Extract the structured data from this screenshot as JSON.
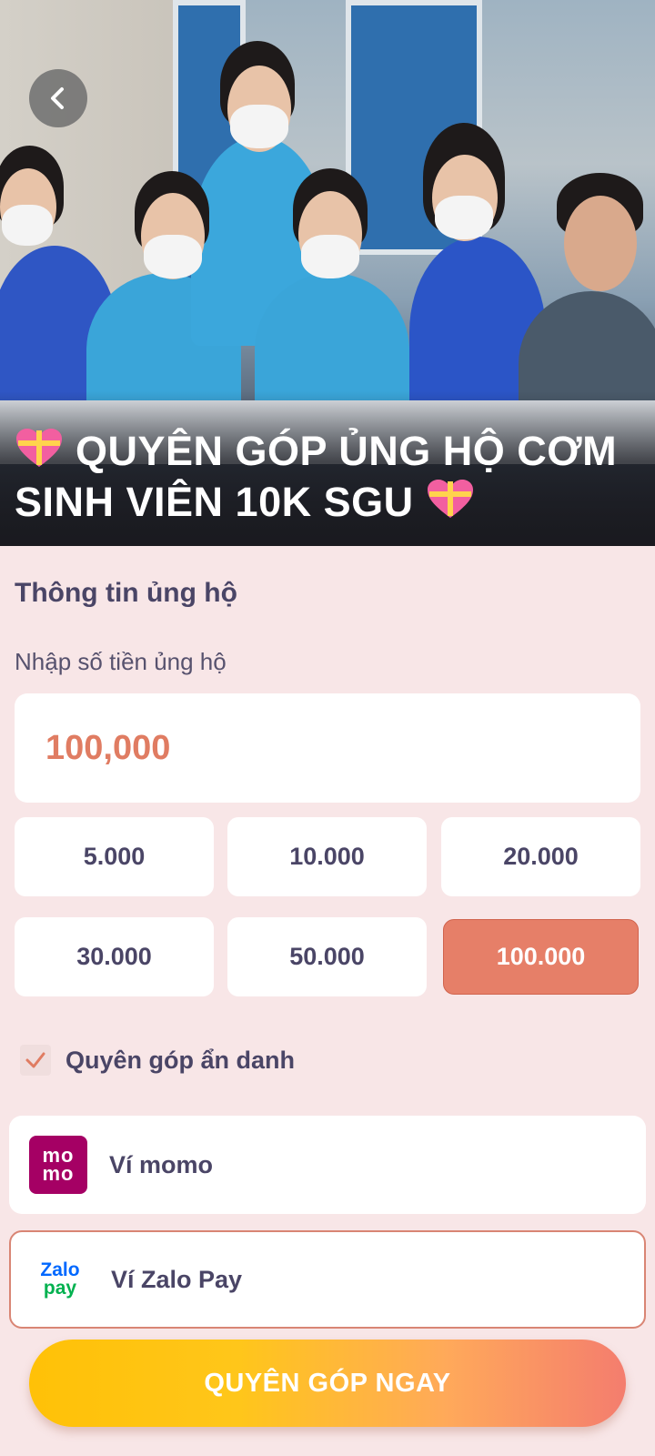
{
  "hero": {
    "title": "QUYÊN GÓP ỦNG HỘ CƠM SINH VIÊN 10K SGU"
  },
  "form": {
    "section_title": "Thông tin ủng hộ",
    "amount_label": "Nhập số tiền ủng hộ",
    "amount_value": "100,000",
    "presets": [
      {
        "label": "5.000",
        "selected": false
      },
      {
        "label": "10.000",
        "selected": false
      },
      {
        "label": "20.000",
        "selected": false
      },
      {
        "label": "30.000",
        "selected": false
      },
      {
        "label": "50.000",
        "selected": false
      },
      {
        "label": "100.000",
        "selected": true
      }
    ],
    "anonymous_label": "Quyên góp ẩn danh",
    "anonymous_checked": true
  },
  "payment": {
    "options": [
      {
        "label": "Ví momo",
        "logo": "momo-logo",
        "logo_text": [
          "mo",
          "mo"
        ],
        "selected": false
      },
      {
        "label": "Ví Zalo Pay",
        "logo": "zalopay-logo",
        "logo_text": [
          "Zalo",
          "pay"
        ],
        "selected": true
      }
    ]
  },
  "cta": {
    "label": "QUYÊN GÓP NGAY"
  },
  "colors": {
    "background": "#f8e6e7",
    "accent": "#e67f68",
    "text": "#4a4566",
    "momo": "#a50064"
  }
}
